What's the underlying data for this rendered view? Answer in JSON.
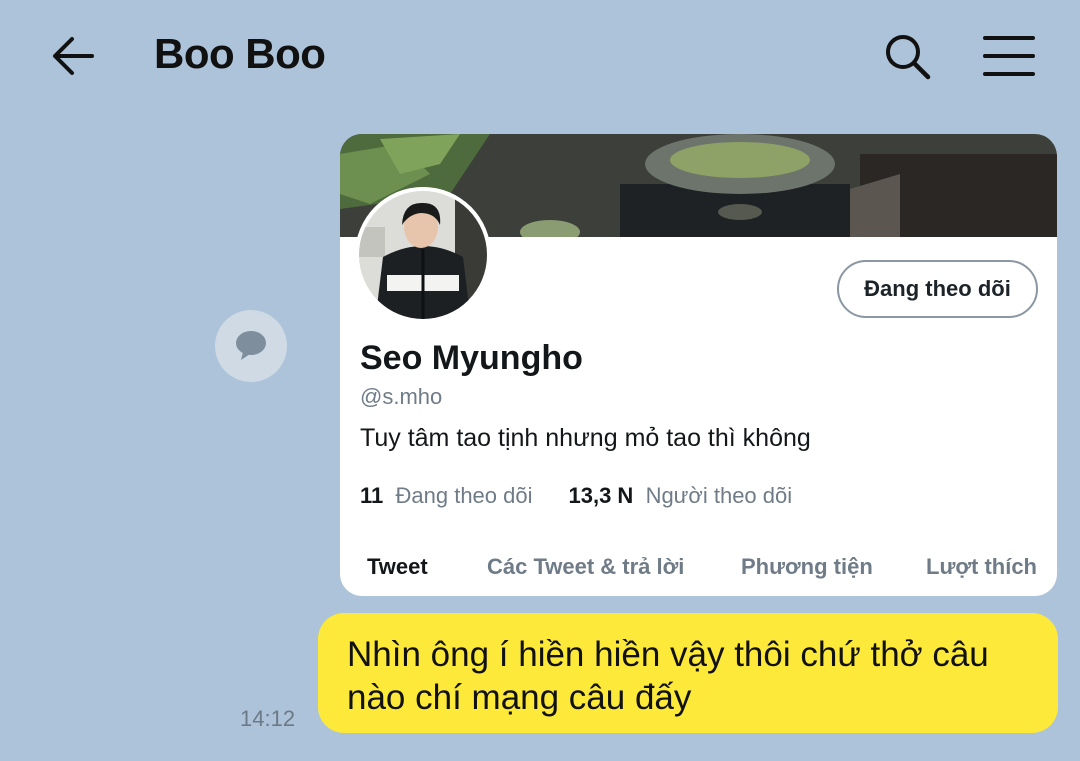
{
  "header": {
    "title": "Boo Boo",
    "icons": [
      "back-arrow-icon",
      "search-icon",
      "menu-icon"
    ]
  },
  "profile_card": {
    "follow_button_label": "Đang theo dõi",
    "name": "Seo Myungho",
    "handle": "@s.mho",
    "bio": "Tuy tâm tao tịnh nhưng mỏ tao thì không",
    "following_count": "11",
    "following_label": "Đang theo dõi",
    "followers_count": "13,3 N",
    "followers_label": "Người theo dõi",
    "tabs": [
      {
        "label": "Tweet",
        "active": true
      },
      {
        "label": "Các Tweet & trả lời",
        "active": false
      },
      {
        "label": "Phương tiện",
        "active": false
      },
      {
        "label": "Lượt thích",
        "active": false
      }
    ]
  },
  "message": {
    "time": "14:12",
    "text": "Nhìn ông í hiền hiền vậy thôi chứ thở câu nào chí mạng câu đấy",
    "bubble_color": "#fde93a"
  },
  "colors": {
    "background": "#adc3d9",
    "accent_text": "#14171a",
    "muted_text": "#6f7c87"
  }
}
